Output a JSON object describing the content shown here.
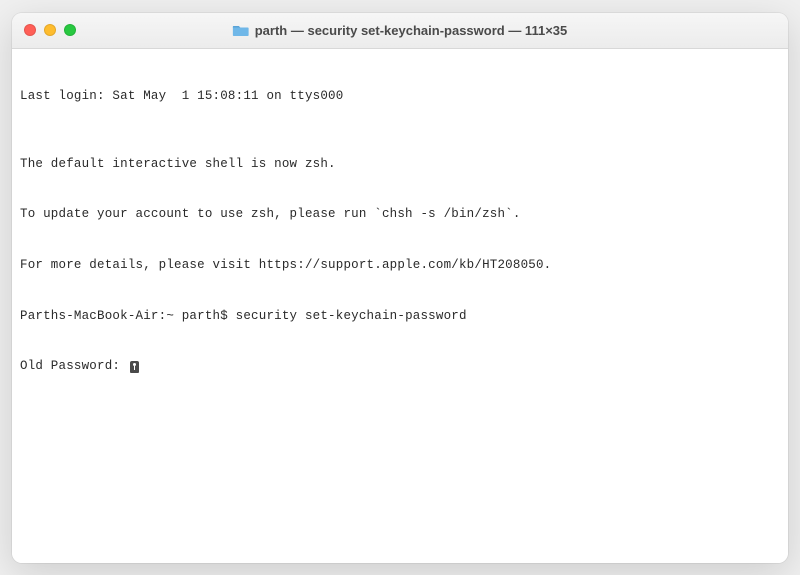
{
  "window": {
    "title": "parth — security set-keychain-password — 111×35"
  },
  "terminal": {
    "lines": {
      "last_login": "Last login: Sat May  1 15:08:11 on ttys000",
      "zsh_notice_1": "The default interactive shell is now zsh.",
      "zsh_notice_2": "To update your account to use zsh, please run `chsh -s /bin/zsh`.",
      "zsh_notice_3": "For more details, please visit https://support.apple.com/kb/HT208050.",
      "prompt_host": "Parths-MacBook-Air:~ parth$ ",
      "prompt_command": "security set-keychain-password",
      "password_prompt": "Old Password: "
    }
  }
}
